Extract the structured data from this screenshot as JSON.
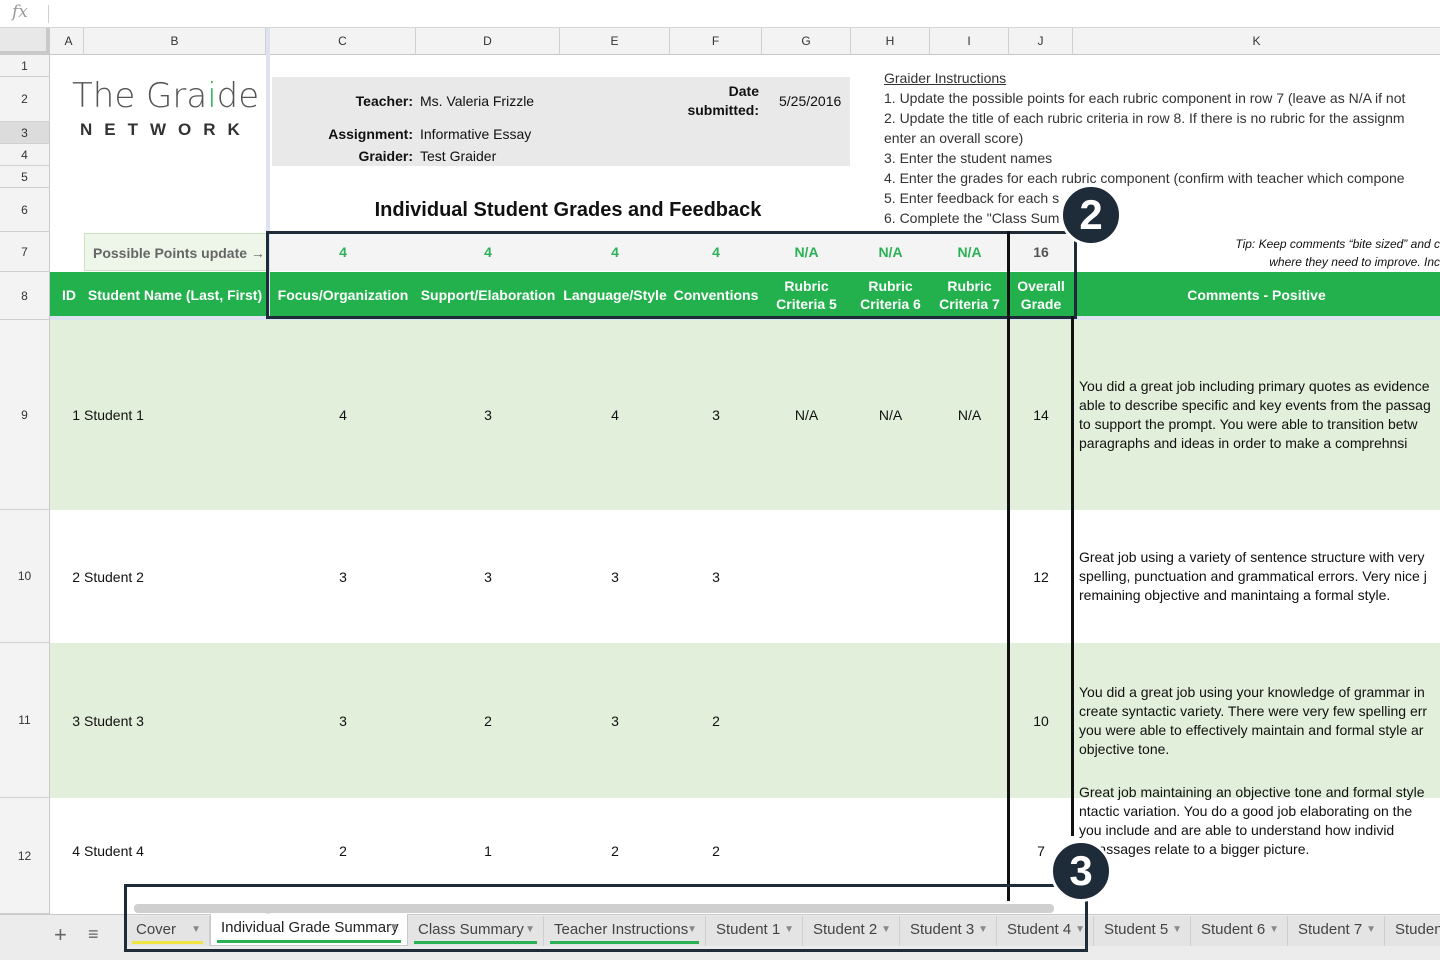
{
  "formula_bar": {
    "fx_icon": "fx",
    "value": ""
  },
  "columns": [
    "A",
    "B",
    "C",
    "D",
    "E",
    "F",
    "G",
    "H",
    "I",
    "J",
    "K"
  ],
  "rows": [
    "1",
    "2",
    "3",
    "4",
    "5",
    "6",
    "7",
    "8",
    "9",
    "10",
    "11",
    "12"
  ],
  "logo": {
    "line1_a": "The Gra",
    "line1_b": "i",
    "line1_c": "de",
    "line2": "NETWORK",
    "accent_color": "#2bb155"
  },
  "info": {
    "teacher_label": "Teacher:",
    "teacher": "Ms. Valeria Frizzle",
    "assignment_label": "Assignment:",
    "assignment": "Informative Essay",
    "grader_label": "Graider:",
    "grader": "Test Graider",
    "date_label_1": "Date",
    "date_label_2": "submitted:",
    "date": "5/25/2016"
  },
  "title": "Individual Student Grades and Feedback",
  "instructions": {
    "heading": "Graider Instructions",
    "lines": [
      "1. Update the possible points for each rubric component in row 7 (leave as N/A if not",
      "2. Update the title of each rubric criteria in row 8. If there is no rubric for the assignm",
      "enter an overall score)",
      "3. Enter the student names",
      "4. Enter the grades for each rubric component (confirm with teacher which compone",
      "5. Enter feedback for each s",
      "6. Complete the \"Class Sum                   b"
    ]
  },
  "tip": {
    "line1": "Tip: Keep comments “bite sized” and c",
    "line2": "where they need to improve. Inc"
  },
  "possible_points": {
    "label": "Possible Points update →",
    "values": [
      "4",
      "4",
      "4",
      "4",
      "N/A",
      "N/A",
      "N/A"
    ],
    "total": "16"
  },
  "headers": {
    "id": "ID",
    "name": "Student Name (Last, First)",
    "c": "Focus/Organization",
    "d": "Support/Elaboration",
    "e": "Language/Style",
    "f": "Conventions",
    "g1": "Rubric",
    "g2": "Criteria 5",
    "h1": "Rubric",
    "h2": "Criteria 6",
    "i1": "Rubric",
    "i2": "Criteria 7",
    "j1": "Overall",
    "j2": "Grade",
    "k": "Comments - Positive"
  },
  "students": [
    {
      "id": "1",
      "name": "Student 1",
      "c": "4",
      "d": "3",
      "e": "4",
      "f": "3",
      "g": "N/A",
      "h": "N/A",
      "i": "N/A",
      "j": "14",
      "comment": [
        "You did a great job including primary quotes as evidence",
        "able to describe specific and key events from the passag",
        "to support the prompt. You were able to transition betw",
        "paragraphs and ideas in order to make a comprehnsi"
      ]
    },
    {
      "id": "2",
      "name": "Student 2",
      "c": "3",
      "d": "3",
      "e": "3",
      "f": "3",
      "g": "",
      "h": "",
      "i": "",
      "j": "12",
      "comment": [
        "Great job using a variety of sentence structure with very",
        "spelling, punctuation and grammatical errors. Very nice j",
        "remaining objective and manintaing a formal style."
      ]
    },
    {
      "id": "3",
      "name": "Student 3",
      "c": "3",
      "d": "2",
      "e": "3",
      "f": "2",
      "g": "",
      "h": "",
      "i": "",
      "j": "10",
      "comment": [
        "You did a great job using your knowledge of grammar in",
        "create syntactic variety. There were very few spelling err",
        "you were able to effectively maintain and formal style ar",
        "objective tone."
      ]
    },
    {
      "id": "4",
      "name": "Student 4",
      "c": "2",
      "d": "1",
      "e": "2",
      "f": "2",
      "g": "",
      "h": "",
      "i": "",
      "j": "7",
      "comment": [
        "Great job maintaining an objective tone and formal style",
        "ntactic variation. You do a good job elaborating on the",
        "you include and are able to understand how individ",
        "e passages relate to a bigger picture."
      ]
    }
  ],
  "annotations": {
    "badge_2": "2",
    "badge_3": "3"
  },
  "tabs": [
    {
      "label": "Cover",
      "underline": "#f0e442"
    },
    {
      "label": "Individual Grade Summary",
      "underline": "#2bb155",
      "active": true
    },
    {
      "label": "Class Summary",
      "underline": "#2bb155"
    },
    {
      "label": "Teacher Instructions",
      "underline": "#2bb155"
    },
    {
      "label": "Student 1"
    },
    {
      "label": "Student 2"
    },
    {
      "label": "Student 3"
    },
    {
      "label": "Student 4"
    },
    {
      "label": "Student 5"
    },
    {
      "label": "Student 6"
    },
    {
      "label": "Student 7"
    },
    {
      "label": "Student"
    }
  ],
  "tab_controls": {
    "add": "+",
    "all": "≡"
  }
}
